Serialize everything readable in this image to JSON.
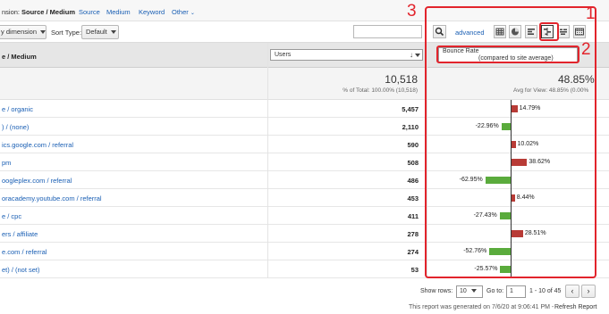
{
  "dimension_bar": {
    "prefix": "nsion:",
    "active": "Source / Medium",
    "options": [
      "Source",
      "Medium",
      "Keyword"
    ],
    "other_label": "Other"
  },
  "controls": {
    "secondary_dimension": "y dimension",
    "sort_type_label": "Sort Type:",
    "sort_type_value": "Default",
    "advanced_link": "advanced"
  },
  "table": {
    "col_source": "e / Medium",
    "col_users": "Users",
    "col_bounce_line1": "Bounce Rate",
    "col_bounce_line2": "(compared to site average)",
    "totals": {
      "users": "10,518",
      "users_sub": "% of Total: 100.00% (10,518)",
      "bounce": "48.85%",
      "bounce_sub": "Avg for View: 48.85% (0.00%"
    },
    "rows": [
      {
        "source": "e / organic",
        "users": "5,457",
        "delta": "14.79%"
      },
      {
        "source": ") / (none)",
        "users": "2,110",
        "delta": "-22.96%"
      },
      {
        "source": "ics.google.com / referral",
        "users": "590",
        "delta": "10.02%"
      },
      {
        "source": "pm",
        "users": "508",
        "delta": "38.62%"
      },
      {
        "source": "oogleplеx.com / referral",
        "users": "486",
        "delta": "-62.95%"
      },
      {
        "source": "oracademy.youtube.com / referral",
        "users": "453",
        "delta": "8.44%"
      },
      {
        "source": "e / cpc",
        "users": "411",
        "delta": "-27.43%"
      },
      {
        "source": "ers / affiliate",
        "users": "278",
        "delta": "28.51%"
      },
      {
        "source": "e.com / referral",
        "users": "274",
        "delta": "-52.76%"
      },
      {
        "source": "et) / (not set)",
        "users": "53",
        "delta": "-25.57%"
      }
    ]
  },
  "chart_data": {
    "type": "bar",
    "categories": [
      "e / organic",
      ") / (none)",
      "ics.google.com / referral",
      "pm",
      "oogleplеx.com / referral",
      "oracademy.youtube.com / referral",
      "e / cpc",
      "ers / affiliate",
      "e.com / referral",
      "et) / (not set)"
    ],
    "values": [
      14.79,
      -22.96,
      10.02,
      38.62,
      -62.95,
      8.44,
      -27.43,
      28.51,
      -52.76,
      -25.57
    ],
    "title": "",
    "ylabel": "",
    "colors": {
      "positive": "#b83b36",
      "negative": "#5aab3c"
    }
  },
  "annotations": {
    "n1": "1",
    "n2": "2",
    "n3": "3",
    "color": "#e2242c"
  },
  "footer": {
    "show_rows_label": "Show rows:",
    "show_rows_value": "10",
    "goto_label": "Go to:",
    "goto_value": "1",
    "range": "1 - 10 of 45",
    "prev": "‹",
    "next": "›",
    "generated": "This report was generated on 7/6/20 at 9:06:41 PM -",
    "refresh": "Refresh Report"
  }
}
